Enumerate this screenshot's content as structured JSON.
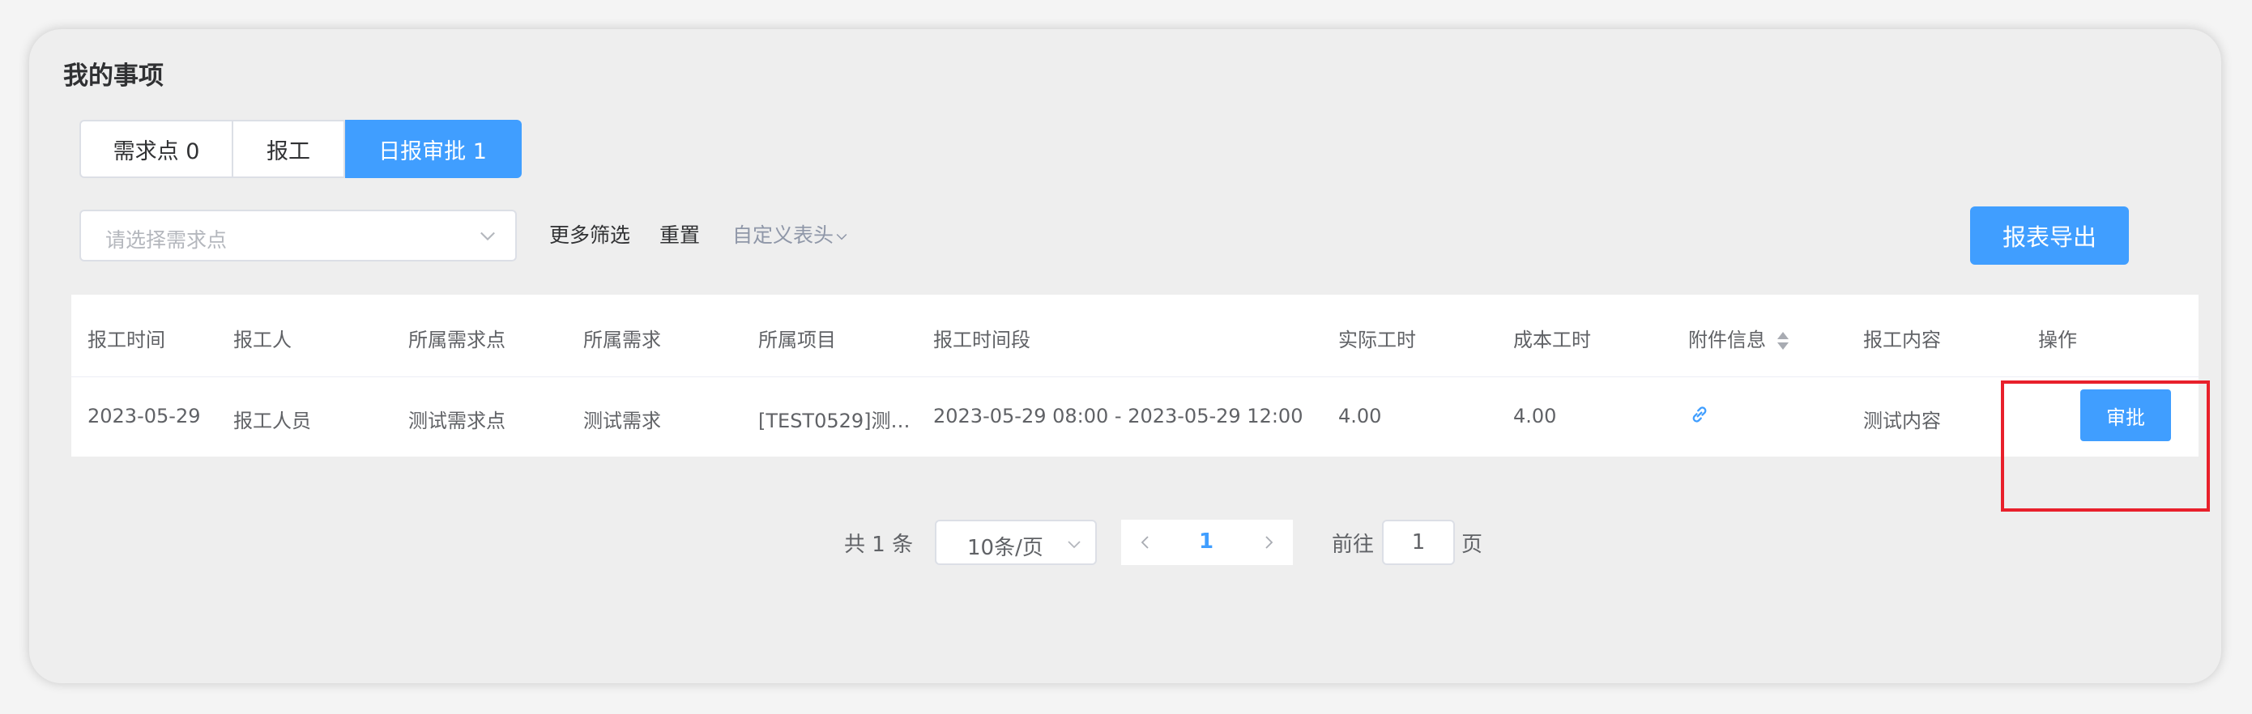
{
  "page": {
    "title": "我的事项"
  },
  "tabs": [
    {
      "label": "需求点 0",
      "active": false
    },
    {
      "label": "报工",
      "active": false
    },
    {
      "label": "日报审批 1",
      "active": true
    }
  ],
  "filters": {
    "select_placeholder": "请选择需求点",
    "more_filters": "更多筛选",
    "reset": "重置",
    "custom_header": "自定义表头",
    "export": "报表导出"
  },
  "table": {
    "headers": [
      "报工时间",
      "报工人",
      "所属需求点",
      "所属需求",
      "所属项目",
      "报工时间段",
      "实际工时",
      "成本工时",
      "附件信息",
      "报工内容",
      "操作"
    ],
    "rows": [
      {
        "date": "2023-05-29",
        "reporter": "报工人员",
        "demand_point": "测试需求点",
        "demand": "测试需求",
        "project": "[TEST0529]测…",
        "period": "2023-05-29 08:00 - 2023-05-29 12:00",
        "actual_hours": "4.00",
        "cost_hours": "4.00",
        "attachment_icon": "link-icon",
        "content": "测试内容",
        "action": "审批"
      }
    ]
  },
  "pagination": {
    "total": "共 1 条",
    "page_size": "10条/页",
    "current_page": "1",
    "goto_label": "前往",
    "goto_value": "1",
    "page_suffix": "页"
  },
  "colors": {
    "primary": "#409eff",
    "highlight": "#e8202b"
  }
}
